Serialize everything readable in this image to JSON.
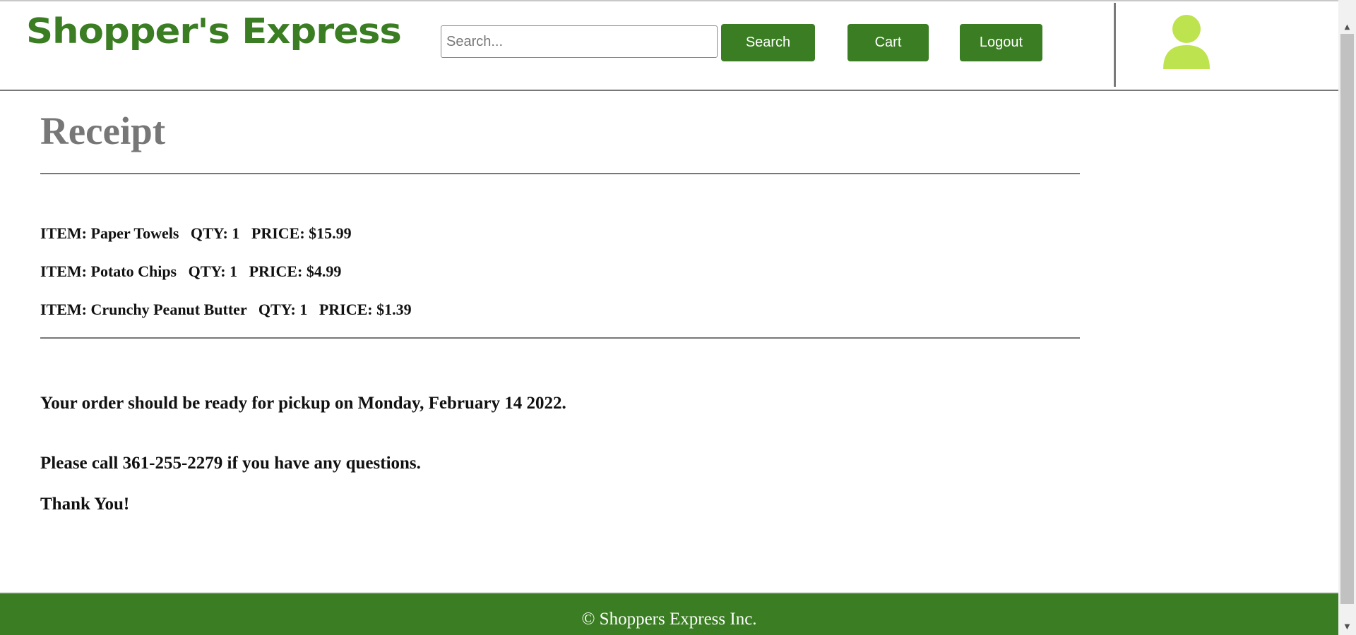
{
  "header": {
    "logo_text": "Shopper's Express",
    "search_placeholder": "Search...",
    "search_value": "",
    "search_button": "Search",
    "cart_button": "Cart",
    "logout_button": "Logout",
    "avatar_icon": "user-avatar-icon"
  },
  "receipt": {
    "title": "Receipt",
    "items": [
      {
        "label": "ITEM:",
        "name": "Paper Towels",
        "qty_label": "QTY:",
        "qty": "1",
        "price_label": "PRICE:",
        "price": "$15.99"
      },
      {
        "label": "ITEM:",
        "name": "Potato Chips",
        "qty_label": "QTY:",
        "qty": "1",
        "price_label": "PRICE:",
        "price": "$4.99"
      },
      {
        "label": "ITEM:",
        "name": "Crunchy Peanut Butter",
        "qty_label": "QTY:",
        "qty": "1",
        "price_label": "PRICE:",
        "price": "$1.39"
      }
    ],
    "pickup_message": "Your order should be ready for pickup on Monday, February 14 2022.",
    "call_message": "Please call 361-255-2279 if you have any questions.",
    "thanks_message": "Thank You!"
  },
  "footer": {
    "text": "© Shoppers Express Inc."
  },
  "colors": {
    "brand_green": "#3a7d22",
    "avatar_green": "#bde34f",
    "title_gray": "#777777"
  }
}
